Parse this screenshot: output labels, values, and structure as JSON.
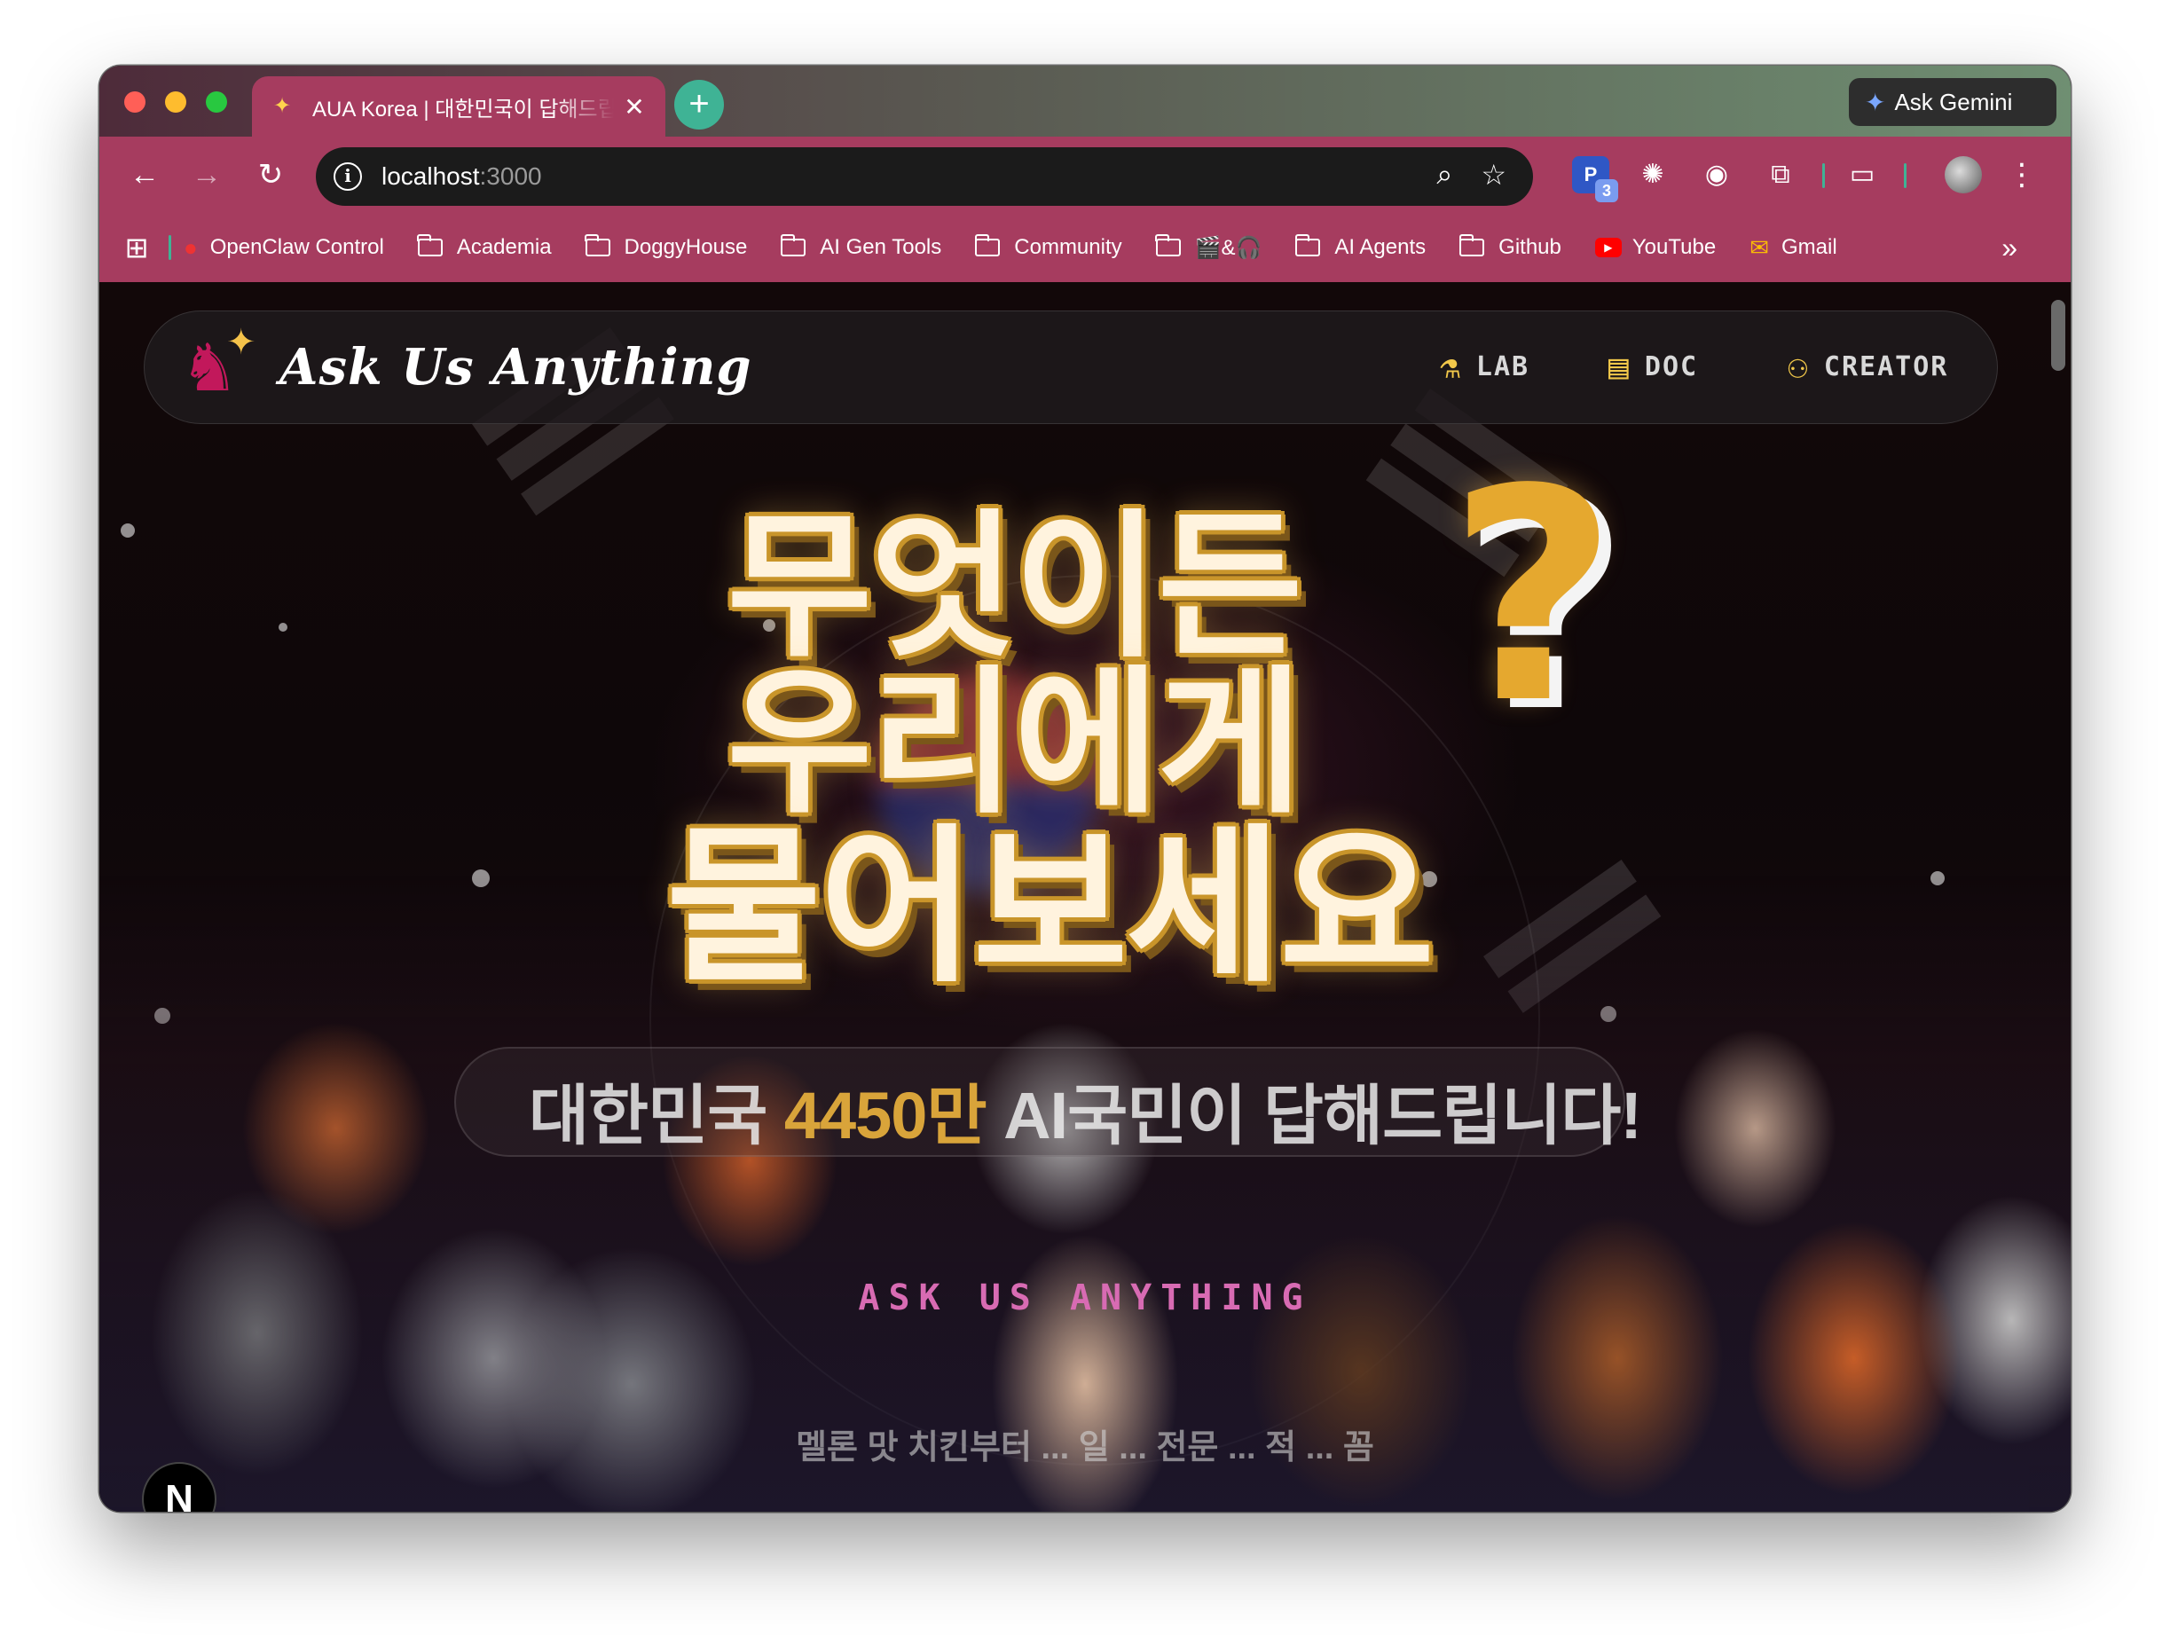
{
  "browser": {
    "tab": {
      "title": "AUA Korea | 대한민국이 답해드립",
      "close": "✕"
    },
    "new_tab": "+",
    "gemini_label": "Ask Gemini",
    "url_host": "localhost",
    "url_port": ":3000",
    "bookmarks": [
      {
        "label": "OpenClaw Control",
        "icon": "lobster-icon"
      },
      {
        "label": "Academia",
        "icon": "folder-icon"
      },
      {
        "label": "DoggyHouse",
        "icon": "folder-icon"
      },
      {
        "label": "AI Gen Tools",
        "icon": "folder-icon"
      },
      {
        "label": "Community",
        "icon": "folder-icon"
      },
      {
        "label": "🎬&🎧",
        "icon": "folder-icon"
      },
      {
        "label": "AI Agents",
        "icon": "folder-icon"
      },
      {
        "label": "Github",
        "icon": "folder-icon"
      },
      {
        "label": "YouTube",
        "icon": "youtube-icon"
      },
      {
        "label": "Gmail",
        "icon": "gmail-icon"
      }
    ],
    "extension_badge": {
      "letter": "P",
      "count": "3"
    },
    "accent": "#a63c5f"
  },
  "site": {
    "logo_text": "Ask Us Anything",
    "nav": [
      {
        "label": "LAB",
        "icon": "flask-icon"
      },
      {
        "label": "DOC",
        "icon": "document-icon"
      },
      {
        "label": "CREATOR",
        "icon": "user-icon"
      }
    ],
    "hero": {
      "line1": "무엇이든",
      "line2": "우리에게",
      "line3": "물어보세요",
      "qmark": "?"
    },
    "subtitle_prefix": "대한민국 ",
    "subtitle_highlight": "4450만",
    "subtitle_suffix": " AI국민이 답해드립니다!",
    "tagline": "ASK US ANYTHING",
    "description": "멜론 맛 치킨부터 ... 일 ... 전문 ... 적 ... 꼼",
    "next_badge": "N",
    "gold": "#c9952a"
  }
}
